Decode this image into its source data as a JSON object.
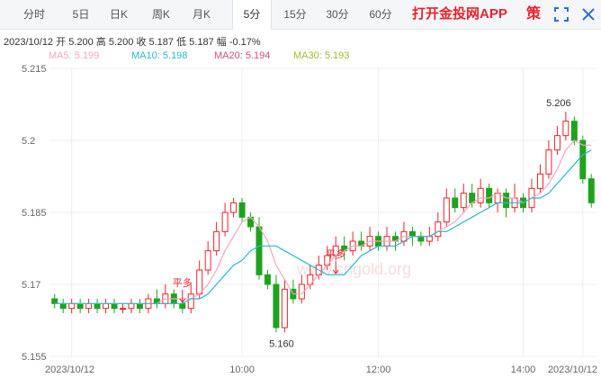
{
  "tabs": [
    {
      "label": "分时",
      "active": false
    },
    {
      "label": "5日",
      "active": false
    },
    {
      "label": "日K",
      "active": false
    },
    {
      "label": "周K",
      "active": false
    },
    {
      "label": "月K",
      "active": false
    },
    {
      "label": "5分",
      "active": true
    },
    {
      "label": "15分",
      "active": false
    },
    {
      "label": "30分",
      "active": false
    },
    {
      "label": "60分",
      "active": false
    }
  ],
  "promo": "打开金投网APP",
  "strategy_label": "策",
  "icons": {
    "expand": "expand-icon",
    "close": "close-icon"
  },
  "info": {
    "date": "2023/10/12",
    "open_label": "开",
    "open": "5.200",
    "high_label": "高",
    "high": "5.200",
    "close_label": "收",
    "close": "5.187",
    "low_label": "低",
    "low": "5.187",
    "change_label": "幅",
    "change": "-0.17%"
  },
  "ma_legend": [
    {
      "label": "MA5: 5.199",
      "color": "#f4a6bd"
    },
    {
      "label": "MA10: 5.198",
      "color": "#2bb8cc"
    },
    {
      "label": "MA20: 5.194",
      "color": "#d94a86"
    },
    {
      "label": "MA30: 5.193",
      "color": "#a3b92f"
    }
  ],
  "markers": [
    {
      "label": "平多",
      "index": 15
    },
    {
      "label": "平多",
      "index": 33
    }
  ],
  "watermark": "www.cngold.org",
  "colors": {
    "up": "#e8232d",
    "down": "#1fa31f",
    "grid": "#eeeeee",
    "axis": "#666666",
    "marker": "#e8232d"
  },
  "chart_data": {
    "type": "candlestick",
    "ylim": [
      5.155,
      5.215
    ],
    "y_ticks": [
      "5.215",
      "5.2",
      "5.185",
      "5.17",
      "5.155"
    ],
    "x_ticks": [
      {
        "label": "2023/10/12",
        "index": 2
      },
      {
        "label": "10:00",
        "index": 22
      },
      {
        "label": "12:00",
        "index": 38
      },
      {
        "label": "14:00",
        "index": 55
      },
      {
        "label": "2023/10/12",
        "index": 62
      }
    ],
    "high_annotation": {
      "label": "5.206",
      "index": 60,
      "value": 5.206
    },
    "low_annotation": {
      "label": "5.160",
      "index": 26,
      "value": 5.16
    },
    "candles": [
      [
        5.167,
        5.166,
        5.168,
        5.165
      ],
      [
        5.166,
        5.165,
        5.167,
        5.164
      ],
      [
        5.165,
        5.166,
        5.167,
        5.164
      ],
      [
        5.166,
        5.165,
        5.167,
        5.164
      ],
      [
        5.165,
        5.166,
        5.167,
        5.164
      ],
      [
        5.166,
        5.165,
        5.167,
        5.164
      ],
      [
        5.165,
        5.166,
        5.167,
        5.164
      ],
      [
        5.166,
        5.165,
        5.167,
        5.164
      ],
      [
        5.165,
        5.165,
        5.166,
        5.164
      ],
      [
        5.165,
        5.166,
        5.167,
        5.164
      ],
      [
        5.166,
        5.165,
        5.167,
        5.164
      ],
      [
        5.165,
        5.167,
        5.168,
        5.164
      ],
      [
        5.167,
        5.166,
        5.169,
        5.165
      ],
      [
        5.166,
        5.168,
        5.17,
        5.165
      ],
      [
        5.168,
        5.166,
        5.169,
        5.165
      ],
      [
        5.166,
        5.165,
        5.167,
        5.164
      ],
      [
        5.165,
        5.168,
        5.17,
        5.164
      ],
      [
        5.168,
        5.173,
        5.175,
        5.167
      ],
      [
        5.173,
        5.177,
        5.179,
        5.172
      ],
      [
        5.177,
        5.181,
        5.183,
        5.176
      ],
      [
        5.181,
        5.185,
        5.187,
        5.18
      ],
      [
        5.185,
        5.187,
        5.188,
        5.184
      ],
      [
        5.187,
        5.184,
        5.188,
        5.183
      ],
      [
        5.184,
        5.182,
        5.185,
        5.181
      ],
      [
        5.182,
        5.172,
        5.184,
        5.171
      ],
      [
        5.172,
        5.17,
        5.173,
        5.169
      ],
      [
        5.17,
        5.161,
        5.172,
        5.16
      ],
      [
        5.161,
        5.169,
        5.171,
        5.16
      ],
      [
        5.169,
        5.167,
        5.171,
        5.166
      ],
      [
        5.167,
        5.17,
        5.172,
        5.166
      ],
      [
        5.17,
        5.172,
        5.174,
        5.169
      ],
      [
        5.172,
        5.174,
        5.176,
        5.171
      ],
      [
        5.174,
        5.176,
        5.178,
        5.173
      ],
      [
        5.176,
        5.178,
        5.18,
        5.175
      ],
      [
        5.178,
        5.177,
        5.18,
        5.175
      ],
      [
        5.177,
        5.179,
        5.181,
        5.176
      ],
      [
        5.179,
        5.178,
        5.181,
        5.177
      ],
      [
        5.178,
        5.18,
        5.182,
        5.177
      ],
      [
        5.18,
        5.178,
        5.181,
        5.177
      ],
      [
        5.178,
        5.18,
        5.182,
        5.177
      ],
      [
        5.18,
        5.179,
        5.181,
        5.177
      ],
      [
        5.179,
        5.181,
        5.183,
        5.178
      ],
      [
        5.181,
        5.18,
        5.182,
        5.178
      ],
      [
        5.18,
        5.179,
        5.181,
        5.178
      ],
      [
        5.179,
        5.18,
        5.182,
        5.178
      ],
      [
        5.18,
        5.183,
        5.185,
        5.179
      ],
      [
        5.183,
        5.188,
        5.19,
        5.182
      ],
      [
        5.188,
        5.186,
        5.19,
        5.185
      ],
      [
        5.186,
        5.189,
        5.191,
        5.185
      ],
      [
        5.189,
        5.187,
        5.191,
        5.186
      ],
      [
        5.187,
        5.19,
        5.192,
        5.186
      ],
      [
        5.19,
        5.187,
        5.191,
        5.186
      ],
      [
        5.187,
        5.189,
        5.19,
        5.185
      ],
      [
        5.189,
        5.186,
        5.19,
        5.184
      ],
      [
        5.186,
        5.188,
        5.191,
        5.185
      ],
      [
        5.188,
        5.186,
        5.189,
        5.185
      ],
      [
        5.186,
        5.19,
        5.192,
        5.185
      ],
      [
        5.19,
        5.193,
        5.195,
        5.189
      ],
      [
        5.193,
        5.198,
        5.2,
        5.192
      ],
      [
        5.198,
        5.201,
        5.203,
        5.197
      ],
      [
        5.201,
        5.204,
        5.206,
        5.2
      ],
      [
        5.204,
        5.2,
        5.205,
        5.199
      ],
      [
        5.2,
        5.192,
        5.201,
        5.191
      ],
      [
        5.192,
        5.187,
        5.193,
        5.186
      ]
    ],
    "ma": {
      "MA5": [
        5.166,
        5.166,
        5.166,
        5.166,
        5.166,
        5.166,
        5.166,
        5.166,
        5.166,
        5.166,
        5.166,
        5.166,
        5.166,
        5.167,
        5.167,
        5.167,
        5.167,
        5.168,
        5.17,
        5.173,
        5.177,
        5.18,
        5.183,
        5.184,
        5.182,
        5.179,
        5.174,
        5.171,
        5.168,
        5.168,
        5.17,
        5.172,
        5.174,
        5.176,
        5.177,
        5.178,
        5.178,
        5.179,
        5.179,
        5.179,
        5.179,
        5.18,
        5.18,
        5.18,
        5.18,
        5.181,
        5.182,
        5.183,
        5.185,
        5.187,
        5.188,
        5.188,
        5.189,
        5.188,
        5.188,
        5.187,
        5.188,
        5.189,
        5.191,
        5.194,
        5.198,
        5.2,
        5.199,
        5.199
      ],
      "MA10": [
        5.166,
        5.166,
        5.166,
        5.166,
        5.166,
        5.166,
        5.166,
        5.166,
        5.166,
        5.166,
        5.166,
        5.166,
        5.166,
        5.166,
        5.166,
        5.166,
        5.167,
        5.167,
        5.168,
        5.17,
        5.172,
        5.174,
        5.175,
        5.177,
        5.178,
        5.178,
        5.178,
        5.177,
        5.176,
        5.175,
        5.174,
        5.173,
        5.172,
        5.172,
        5.172,
        5.174,
        5.176,
        5.177,
        5.178,
        5.178,
        5.178,
        5.179,
        5.18,
        5.18,
        5.18,
        5.181,
        5.181,
        5.182,
        5.183,
        5.184,
        5.185,
        5.186,
        5.187,
        5.187,
        5.187,
        5.187,
        5.188,
        5.188,
        5.189,
        5.191,
        5.193,
        5.195,
        5.197,
        5.198
      ]
    }
  }
}
